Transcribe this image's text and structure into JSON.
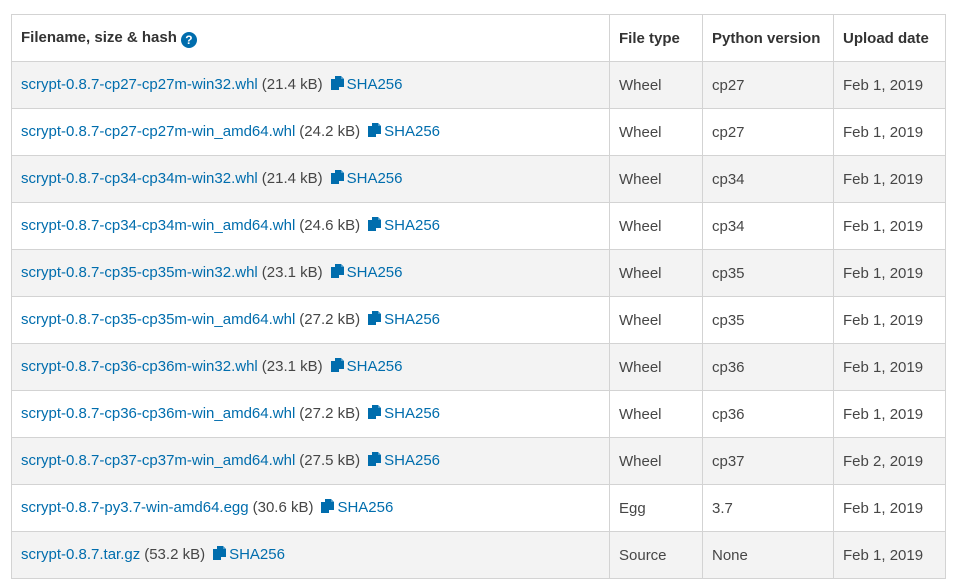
{
  "header": {
    "filename": "Filename, size & hash",
    "help_icon": "?",
    "file_type": "File type",
    "python_version": "Python version",
    "upload_date": "Upload date"
  },
  "hash_label": "SHA256",
  "rows": [
    {
      "filename": "scrypt-0.8.7-cp27-cp27m-win32.whl",
      "size": "(21.4 kB)",
      "type": "Wheel",
      "python": "cp27",
      "date": "Feb 1, 2019"
    },
    {
      "filename": "scrypt-0.8.7-cp27-cp27m-win_amd64.whl",
      "size": "(24.2 kB)",
      "type": "Wheel",
      "python": "cp27",
      "date": "Feb 1, 2019"
    },
    {
      "filename": "scrypt-0.8.7-cp34-cp34m-win32.whl",
      "size": "(21.4 kB)",
      "type": "Wheel",
      "python": "cp34",
      "date": "Feb 1, 2019"
    },
    {
      "filename": "scrypt-0.8.7-cp34-cp34m-win_amd64.whl",
      "size": "(24.6 kB)",
      "type": "Wheel",
      "python": "cp34",
      "date": "Feb 1, 2019"
    },
    {
      "filename": "scrypt-0.8.7-cp35-cp35m-win32.whl",
      "size": "(23.1 kB)",
      "type": "Wheel",
      "python": "cp35",
      "date": "Feb 1, 2019"
    },
    {
      "filename": "scrypt-0.8.7-cp35-cp35m-win_amd64.whl",
      "size": "(27.2 kB)",
      "type": "Wheel",
      "python": "cp35",
      "date": "Feb 1, 2019"
    },
    {
      "filename": "scrypt-0.8.7-cp36-cp36m-win32.whl",
      "size": "(23.1 kB)",
      "type": "Wheel",
      "python": "cp36",
      "date": "Feb 1, 2019"
    },
    {
      "filename": "scrypt-0.8.7-cp36-cp36m-win_amd64.whl",
      "size": "(27.2 kB)",
      "type": "Wheel",
      "python": "cp36",
      "date": "Feb 1, 2019"
    },
    {
      "filename": "scrypt-0.8.7-cp37-cp37m-win_amd64.whl",
      "size": "(27.5 kB)",
      "type": "Wheel",
      "python": "cp37",
      "date": "Feb 2, 2019"
    },
    {
      "filename": "scrypt-0.8.7-py3.7-win-amd64.egg",
      "size": "(30.6 kB)",
      "type": "Egg",
      "python": "3.7",
      "date": "Feb 1, 2019"
    },
    {
      "filename": "scrypt-0.8.7.tar.gz",
      "size": "(53.2 kB)",
      "type": "Source",
      "python": "None",
      "date": "Feb 1, 2019"
    }
  ]
}
